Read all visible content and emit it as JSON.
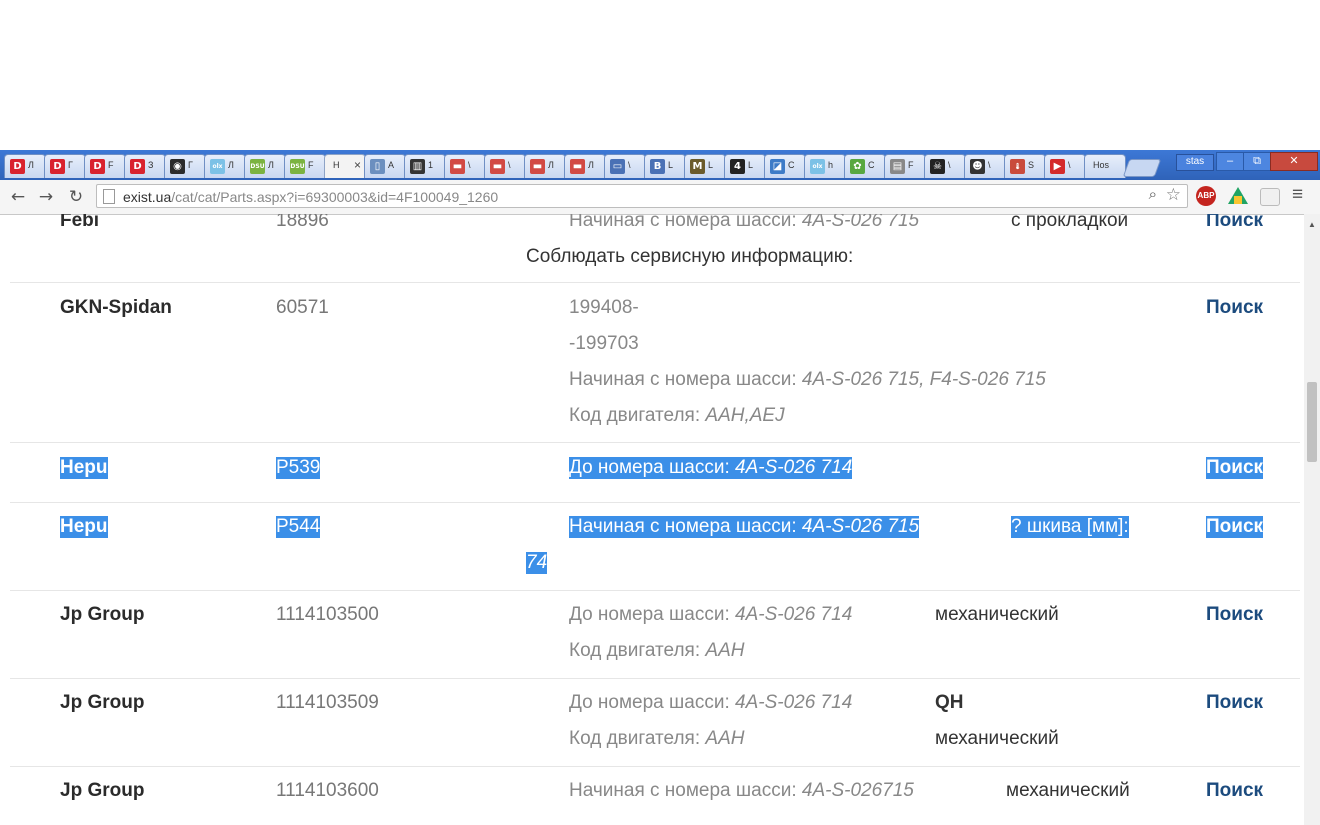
{
  "browser": {
    "tabs": [
      {
        "icon": "D",
        "label": "Л",
        "color": "#d9232e"
      },
      {
        "icon": "D",
        "label": "Г",
        "color": "#d9232e"
      },
      {
        "icon": "D",
        "label": "F",
        "color": "#d9232e"
      },
      {
        "icon": "D",
        "label": "З",
        "color": "#d9232e"
      },
      {
        "icon": "◉",
        "label": "Г",
        "color": "#2b2b2b"
      },
      {
        "icon": "olx",
        "label": "Л",
        "color": "#7cc1e6"
      },
      {
        "icon": "DSU",
        "label": "Л",
        "color": "#7bb340"
      },
      {
        "icon": "DSU",
        "label": "F",
        "color": "#7bb340"
      },
      {
        "icon": "",
        "label": "Н",
        "color": "#f3f3f3"
      },
      {
        "icon": "▯",
        "label": "А",
        "color": "#6b8fbf"
      },
      {
        "icon": "▥",
        "label": "1",
        "color": "#333333"
      },
      {
        "icon": "▬",
        "label": "\\",
        "color": "#d24a44"
      },
      {
        "icon": "▬",
        "label": "\\",
        "color": "#d24a44"
      },
      {
        "icon": "▬",
        "label": "Л",
        "color": "#d24a44"
      },
      {
        "icon": "▬",
        "label": "Л",
        "color": "#d24a44"
      },
      {
        "icon": "▭",
        "label": "\\",
        "color": "#4a71b5"
      },
      {
        "icon": "B",
        "label": "L",
        "color": "#4a71b5"
      },
      {
        "icon": "M",
        "label": "L",
        "color": "#6b5b2b"
      },
      {
        "icon": "4",
        "label": "L",
        "color": "#222222"
      },
      {
        "icon": "◪",
        "label": "С",
        "color": "#3d7bc7"
      },
      {
        "icon": "olx",
        "label": "h",
        "color": "#7cc1e6"
      },
      {
        "icon": "✿",
        "label": "С",
        "color": "#58a840"
      },
      {
        "icon": "▤",
        "label": "F",
        "color": "#888888"
      },
      {
        "icon": "☠",
        "label": "\\",
        "color": "#222222"
      },
      {
        "icon": "☻",
        "label": "\\",
        "color": "#333333"
      },
      {
        "icon": "🌡",
        "label": "S",
        "color": "#c94b3c"
      },
      {
        "icon": "▶",
        "label": "\\",
        "color": "#d42a2a"
      },
      {
        "icon": "",
        "label": "Hos",
        "color": "#c9d8f1"
      }
    ],
    "active_tab_close": "×",
    "user_name": "stas",
    "window_buttons": {
      "minimize": "–",
      "restore": "⧉",
      "close": "✕"
    },
    "url_host": "exist.ua",
    "url_path": "/cat/cat/Parts.aspx?i=69300003&id=4F100049_1260",
    "abp_label": "ABP"
  },
  "rows": [
    {
      "brand": "Febi",
      "number": "18896",
      "lines": [
        {
          "label": "Начиная с номера шасси: ",
          "value": "4A-S-026 715"
        }
      ],
      "note": "с прокладкой",
      "extra": "Соблюдать сервисную информацию:",
      "search": "Поиск",
      "selected": false
    },
    {
      "brand": "GKN-Spidan",
      "number": "60571",
      "lines": [
        {
          "label": "199408-",
          "value": ""
        },
        {
          "label": "-199703",
          "value": ""
        },
        {
          "label": "Начиная с номера шасси: ",
          "value": "4A-S-026 715, F4-S-026 715"
        },
        {
          "label": "Код двигателя: ",
          "value": "AAH,AEJ"
        }
      ],
      "note": "",
      "search": "Поиск",
      "selected": false
    },
    {
      "brand": "Hepu",
      "number": "P539",
      "lines": [
        {
          "label": "До номера шасси: ",
          "value": "4A-S-026 714"
        }
      ],
      "note": "",
      "search": "Поиск",
      "selected": true
    },
    {
      "brand": "Hepu",
      "number": "P544",
      "lines": [
        {
          "label": "Начиная с номера шасси: ",
          "value": "4A-S-026 715"
        }
      ],
      "note": "? шкива [мм]:",
      "wrap_value": "74",
      "search": "Поиск",
      "selected": true
    },
    {
      "brand": "Jp Group",
      "number": "1114103500",
      "lines": [
        {
          "label": "До номера шасси: ",
          "value": "4A-S-026 714"
        },
        {
          "label": "Код двигателя: ",
          "value": "AAH"
        }
      ],
      "note": "механический",
      "search": "Поиск",
      "selected": false
    },
    {
      "brand": "Jp Group",
      "number": "1114103509",
      "lines": [
        {
          "label": "До номера шасси: ",
          "value": "4A-S-026 714"
        },
        {
          "label": "Код двигателя: ",
          "value": "AAH"
        }
      ],
      "note_bold": "QH",
      "note": "механический",
      "search": "Поиск",
      "selected": false
    },
    {
      "brand": "Jp Group",
      "number": "1114103600",
      "lines": [
        {
          "label": "Начиная с номера шасси: ",
          "value": "4A-S-026715"
        }
      ],
      "note": "механический",
      "search": "Поиск",
      "selected": false
    }
  ]
}
